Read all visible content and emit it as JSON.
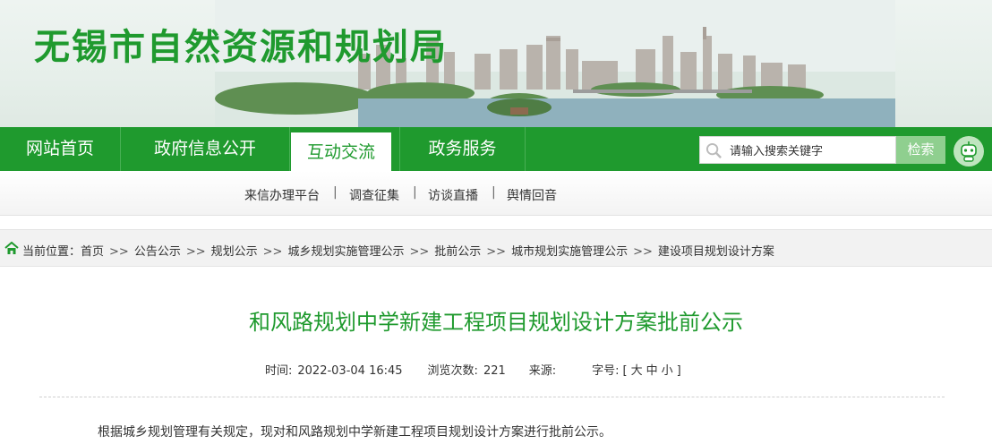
{
  "header": {
    "site_title": "无锡市自然资源和规划局"
  },
  "nav": {
    "items": [
      {
        "label": "网站首页"
      },
      {
        "label": "政府信息公开"
      },
      {
        "label": "互动交流"
      },
      {
        "label": "政务服务"
      }
    ],
    "active_index": 2,
    "search": {
      "placeholder": "请输入搜索关键字",
      "value": "请输入搜索关键字",
      "button_label": "检索"
    }
  },
  "subnav": {
    "items": [
      {
        "label": "来信办理平台"
      },
      {
        "label": "调查征集"
      },
      {
        "label": "访谈直播"
      },
      {
        "label": "舆情回音"
      }
    ],
    "separator": "|"
  },
  "breadcrumb": {
    "prefix": "当前位置：",
    "items": [
      "首页",
      "公告公示",
      "规划公示",
      "城乡规划实施管理公示",
      "批前公示",
      "城市规划实施管理公示",
      "建设项目规划设计方案"
    ],
    "arrow": ">>"
  },
  "article": {
    "title": "和风路规划中学新建工程项目规划设计方案批前公示",
    "meta": {
      "time_label": "时间:",
      "time_value": "2022-03-04 16:45",
      "views_label": "浏览次数:",
      "views_value": "221",
      "source_label": "来源:",
      "source_value": "",
      "fontsize_label": "字号:",
      "bracket_open": "[",
      "fs_large": "大",
      "fs_medium": "中",
      "fs_small": "小",
      "bracket_close": "]"
    },
    "body": "根据城乡规划管理有关规定，现对和风路规划中学新建工程项目规划设计方案进行批前公示。"
  },
  "colors": {
    "brand_green": "#1f9a2e",
    "search_button": "#8fcf8f"
  },
  "icons": [
    "search-icon",
    "robot-assistant-icon",
    "home-icon"
  ]
}
